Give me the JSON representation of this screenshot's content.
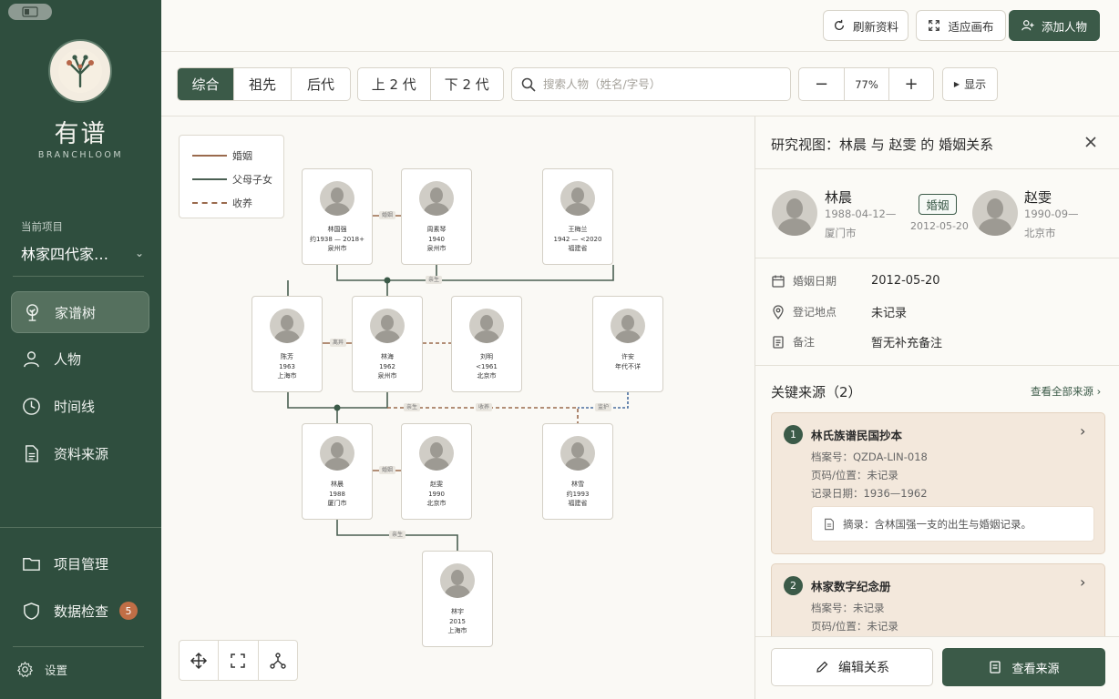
{
  "app": {
    "name": "有谱",
    "subtitle": "BRANCHLOOM"
  },
  "sidebar": {
    "project_label": "当前项目",
    "project_name": "林家四代家…",
    "nav": [
      {
        "label": "家谱树",
        "icon": "tree-icon",
        "active": true
      },
      {
        "label": "人物",
        "icon": "person-icon"
      },
      {
        "label": "时间线",
        "icon": "clock-icon"
      },
      {
        "label": "资料来源",
        "icon": "document-icon"
      }
    ],
    "bottom_nav": [
      {
        "label": "项目管理",
        "icon": "folder-icon"
      },
      {
        "label": "数据检查",
        "icon": "shield-icon",
        "badge": "5"
      }
    ],
    "settings_label": "设置"
  },
  "topbar": {
    "refresh_label": "刷新资料",
    "fit_label": "适应画布",
    "add_label": "添加人物"
  },
  "toolbar": {
    "view_tabs": [
      "综合",
      "祖先",
      "后代"
    ],
    "active_view": "综合",
    "gen_tabs": [
      "上 2 代",
      "下 2 代"
    ],
    "search_placeholder": "搜索人物（姓名/字号）",
    "zoom_value": "77%",
    "show_label": "显示"
  },
  "legend": {
    "items": [
      {
        "label": "婚姻",
        "color": "#9a6a4d",
        "style": "solid"
      },
      {
        "label": "父母子女",
        "color": "#4a5f52",
        "style": "solid"
      },
      {
        "label": "收养",
        "color": "#9a6a4d",
        "style": "dashed"
      }
    ]
  },
  "tree": {
    "people": {
      "lin_guoqiang": {
        "name": "林国强",
        "years": "约1938 — 2018+",
        "place": "泉州市"
      },
      "zhou_suqin": {
        "name": "周素琴",
        "years": "1940",
        "place": "泉州市"
      },
      "wang_meilan": {
        "name": "王梅兰",
        "years": "1942 — <2020",
        "place": "福建省"
      },
      "chen_fang": {
        "name": "陈芳",
        "years": "1963",
        "place": "上海市"
      },
      "lin_hai": {
        "name": "林海",
        "years": "1962",
        "place": "泉州市"
      },
      "liu_ming": {
        "name": "刘明",
        "years": "<1961",
        "place": "北京市"
      },
      "xu_an": {
        "name": "许安",
        "years": "年代不详",
        "place": ""
      },
      "lin_chen": {
        "name": "林晨",
        "years": "1988",
        "place": "厦门市"
      },
      "zhao_wen": {
        "name": "赵雯",
        "years": "1990",
        "place": "北京市"
      },
      "lin_xue": {
        "name": "林雪",
        "years": "约1993",
        "place": "福建省"
      },
      "lin_yu": {
        "name": "林宇",
        "years": "2015",
        "place": "上海市"
      }
    },
    "tags": {
      "marriage": "婚姻",
      "divorced": "离异",
      "bio": "亲生",
      "adopted": "收养",
      "guardian": "监护"
    }
  },
  "panel": {
    "title": "研究视图：林晨 与 赵雯 的 婚姻关系",
    "person_a": {
      "name": "林晨",
      "dates": "1988-04-12—",
      "place": "厦门市"
    },
    "person_b": {
      "name": "赵雯",
      "dates": "1990-09—",
      "place": "北京市"
    },
    "relation": "婚姻",
    "relation_date": "2012-05-20",
    "fields": [
      {
        "key": "婚姻日期",
        "value": "2012-05-20",
        "icon": "calendar-icon"
      },
      {
        "key": "登记地点",
        "value": "未记录",
        "icon": "location-pin-icon"
      },
      {
        "key": "备注",
        "value": "暂无补充备注",
        "icon": "note-icon"
      }
    ],
    "sources_title": "关键来源（2）",
    "sources_all": "查看全部来源",
    "sources": [
      {
        "num": "1",
        "name": "林氏族谱民国抄本",
        "archive": "档案号：QZDA-LIN-018",
        "page": "页码/位置：未记录",
        "date": "记录日期：1936—1962",
        "excerpt": "摘录：含林国强一支的出生与婚姻记录。"
      },
      {
        "num": "2",
        "name": "林家数字纪念册",
        "archive": "档案号：未记录",
        "page": "页码/位置：未记录"
      }
    ],
    "edit_label": "编辑关系",
    "view_source_label": "查看来源"
  }
}
